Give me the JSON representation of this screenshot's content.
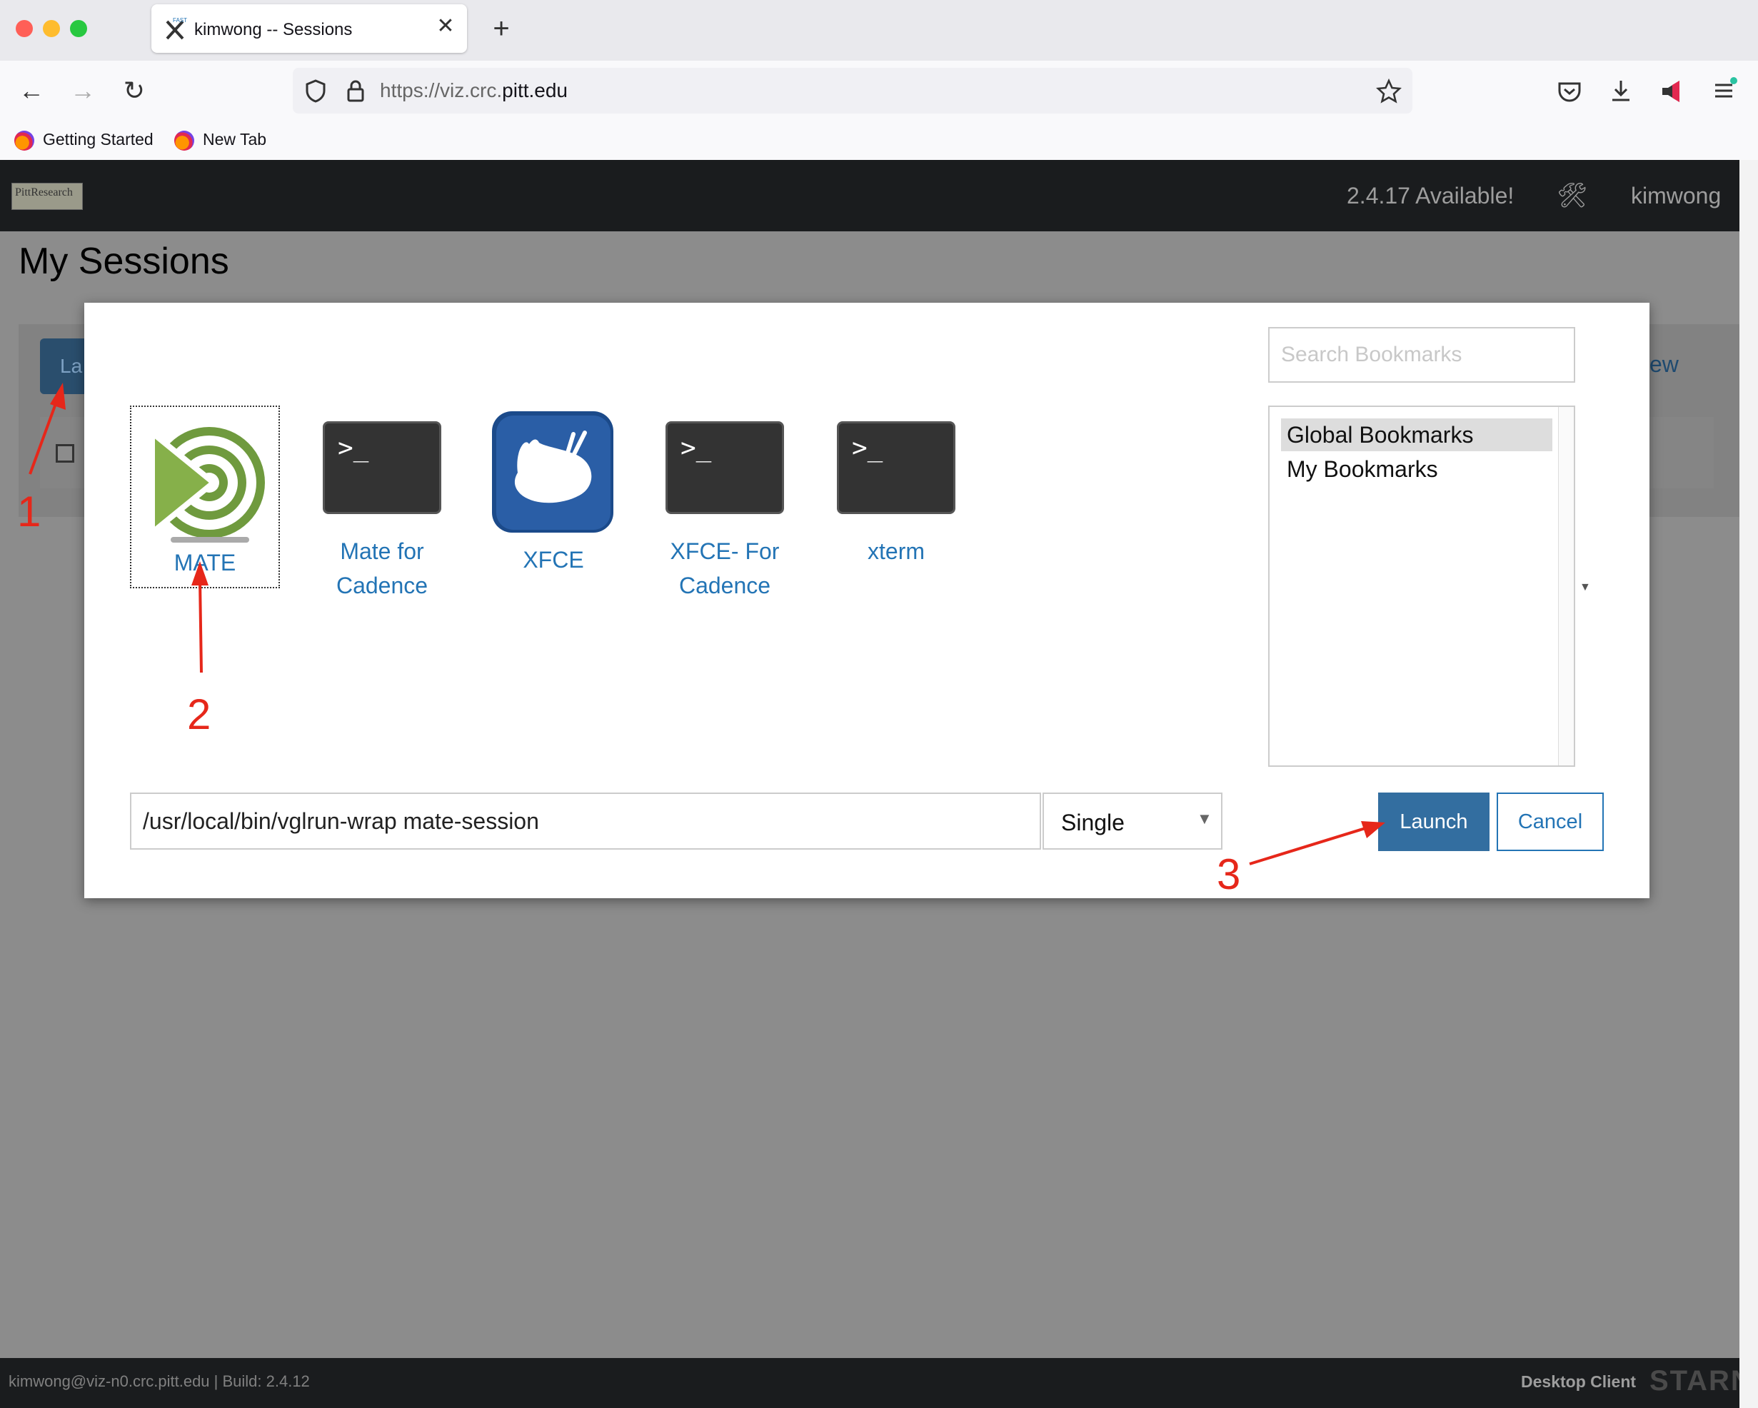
{
  "browser": {
    "tab_title": "kimwong -- Sessions",
    "tab_close": "✕",
    "new_tab": "+",
    "url_prefix": "https://viz.crc.",
    "url_domain": "pitt.edu",
    "bookmarks": [
      "Getting Started",
      "New Tab"
    ]
  },
  "app": {
    "logo": "PittResearch",
    "update_notice": "2.4.17 Available!",
    "tools_icon": "🛠",
    "user": "kimwong",
    "page_title": "My Sessions",
    "bg_launch": "La",
    "bg_view": "ew",
    "footer_text": "kimwong@viz-n0.crc.pitt.edu | Build: 2.4.12",
    "footer_client": "Desktop Client",
    "footer_logo": "STARNE"
  },
  "modal": {
    "apps": [
      {
        "label": "MATE",
        "icon": "mate-icon"
      },
      {
        "label": "Mate for Cadence",
        "icon": "terminal-icon"
      },
      {
        "label": "XFCE",
        "icon": "xfce-icon"
      },
      {
        "label": "XFCE- For Cadence",
        "icon": "terminal-icon"
      },
      {
        "label": "xterm",
        "icon": "terminal-icon"
      }
    ],
    "terminal_prompt": ">_",
    "search_placeholder": "Search Bookmarks",
    "bookmark_groups": [
      "Global Bookmarks",
      "My Bookmarks"
    ],
    "command": "/usr/local/bin/vglrun-wrap mate-session",
    "mode": "Single",
    "launch_label": "Launch",
    "cancel_label": "Cancel"
  },
  "annotations": [
    "1",
    "2",
    "3"
  ],
  "colors": {
    "accent": "#336ea0",
    "link": "#2374b5",
    "annotation": "#e6271a"
  }
}
